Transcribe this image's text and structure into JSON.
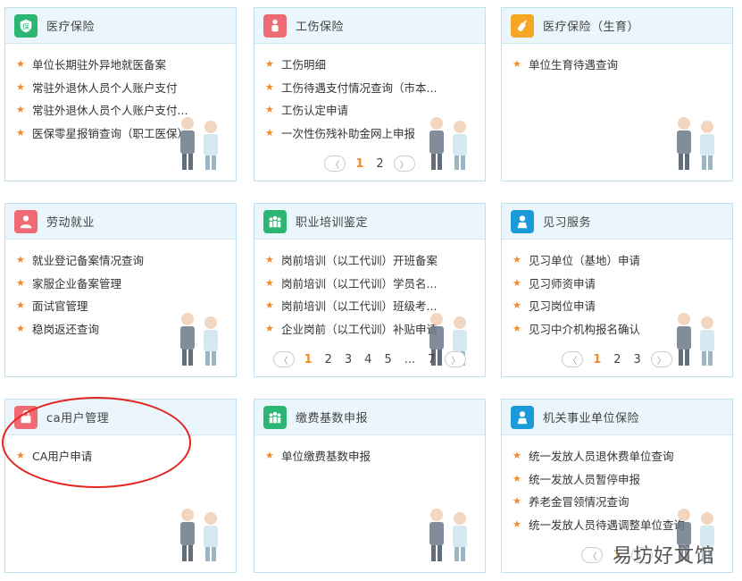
{
  "cards": [
    {
      "title": "医疗保险",
      "icon": "shield-icon",
      "icon_color": "#2bb673",
      "items": [
        "单位长期驻外异地就医备案",
        "常驻外退休人员个人账户支付",
        "常驻外退休人员个人账户支付...",
        "医保零星报销查询（职工医保）"
      ],
      "pager": null
    },
    {
      "title": "工伤保险",
      "icon": "injury-icon",
      "icon_color": "#ef6b73",
      "items": [
        "工伤明细",
        "工伤待遇支付情况查询（市本...",
        "工伤认定申请",
        "一次性伤残补助金网上申报"
      ],
      "pager": {
        "pages": [
          "1",
          "2"
        ],
        "active": "1"
      }
    },
    {
      "title": "医疗保险（生育）",
      "icon": "bottle-icon",
      "icon_color": "#f5a623",
      "items": [
        "单位生育待遇查询"
      ],
      "pager": null
    },
    {
      "title": "劳动就业",
      "icon": "worker-icon",
      "icon_color": "#ef6b73",
      "items": [
        "就业登记备案情况查询",
        "家服企业备案管理",
        "面试官管理",
        "稳岗返还查询"
      ],
      "pager": null
    },
    {
      "title": "职业培训鉴定",
      "icon": "group-icon",
      "icon_color": "#2bb673",
      "items": [
        "岗前培训（以工代训）开班备案",
        "岗前培训（以工代训）学员名...",
        "岗前培训（以工代训）班级考...",
        "企业岗前（以工代训）补贴申请"
      ],
      "pager": {
        "pages": [
          "1",
          "2",
          "3",
          "4",
          "5",
          "...",
          "7"
        ],
        "active": "1"
      }
    },
    {
      "title": "见习服务",
      "icon": "person-icon",
      "icon_color": "#1a9bd7",
      "items": [
        "见习单位（基地）申请",
        "见习师资申请",
        "见习岗位申请",
        "见习中介机构报名确认"
      ],
      "pager": {
        "pages": [
          "1",
          "2",
          "3"
        ],
        "active": "1"
      }
    },
    {
      "title": "ca用户管理",
      "icon": "ca-icon",
      "icon_color": "#ef6b73",
      "items": [
        "CA用户申请"
      ],
      "pager": null
    },
    {
      "title": "缴费基数申报",
      "icon": "group-icon",
      "icon_color": "#2bb673",
      "items": [
        "单位缴费基数申报"
      ],
      "pager": null
    },
    {
      "title": "机关事业单位保险",
      "icon": "person-icon",
      "icon_color": "#1a9bd7",
      "items": [
        "统一发放人员退休费单位查询",
        "统一发放人员暂停申报",
        "养老金冒领情况查询",
        "统一发放人员待遇调整单位查询"
      ],
      "pager": {
        "pages": [
          "1"
        ],
        "active": "1"
      }
    }
  ],
  "watermark": "易坊好文馆"
}
